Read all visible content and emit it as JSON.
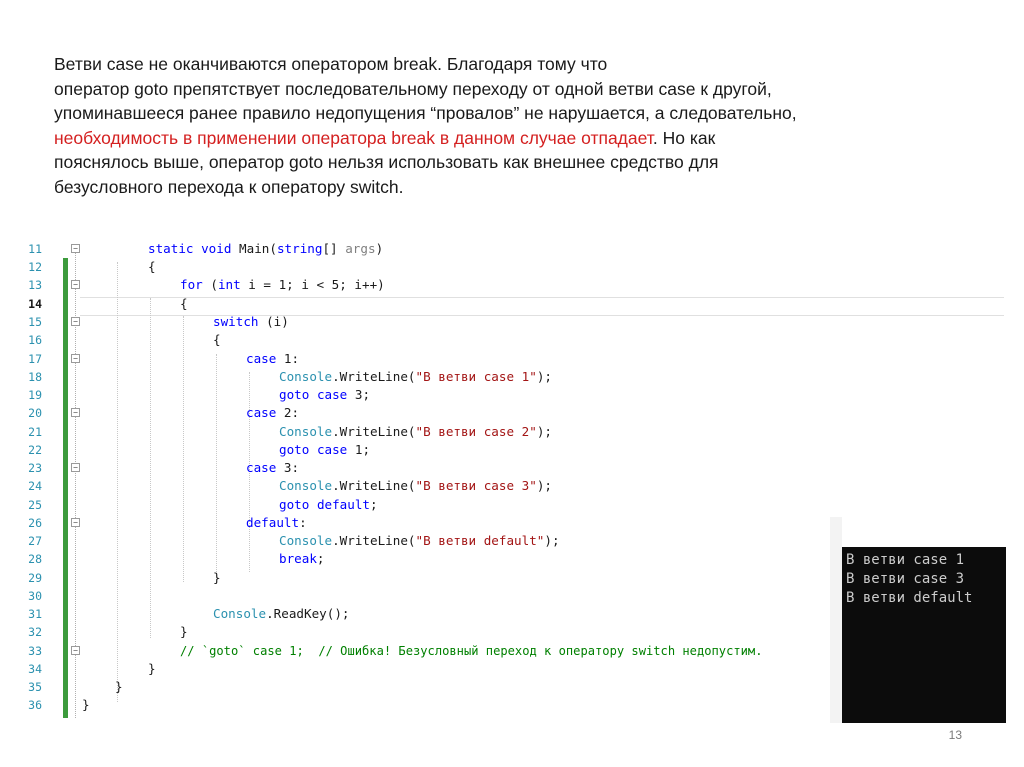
{
  "paragraph": {
    "line1": " Ветви case  не оканчиваются оператором break. Благодаря тому что",
    "line2": "оператор goto препятствует последовательному переходу от одной ветви case к другой,",
    "line3": "упоминавшееся ранее правило недопущения “провалов” не нарушается, а следовательно,",
    "line4_red": "необходимость в применении оператора break в данном случае отпадает",
    "line4_rest": ". Но как",
    "line5": "пояснялось выше, оператор goto нельзя использовать как внешнее средство для",
    "line6": "безусловного перехода к оператору switch."
  },
  "code": {
    "line_numbers": [
      "11",
      "12",
      "13",
      "14",
      "15",
      "16",
      "17",
      "18",
      "19",
      "20",
      "21",
      "22",
      "23",
      "24",
      "25",
      "26",
      "27",
      "28",
      "29",
      "30",
      "31",
      "32",
      "33",
      "34",
      "35",
      "36"
    ],
    "current_line": "14",
    "tokens": {
      "static": "static",
      "void": "void",
      "main": "Main",
      "string": "string",
      "args_sig_rest": "[] ",
      "args": "args",
      "paren_close": ")",
      "paren_open": "(",
      "brace_open": "{",
      "brace_close": "}",
      "for": "for",
      "int": "int",
      "for_rest": " i = 1; i < 5; i++)",
      "switch": "switch",
      "switch_rest": " (i)",
      "case": "case",
      "case1_rest": " 1:",
      "case2_rest": " 2:",
      "case3_rest": " 3:",
      "default": "default",
      "colon": ":",
      "console": "Console",
      "writeline": ".WriteLine(",
      "str1": "\"В ветви case 1\"",
      "str2": "\"В ветви case 2\"",
      "str3": "\"В ветви case 3\"",
      "str_default": "\"В ветви default\"",
      "close_semi": ");",
      "goto": "goto",
      "goto_case3_rest": " 3;",
      "goto_case1_rest": " 1;",
      "semi": ";",
      "break": "break",
      "readkey": ".ReadKey();",
      "comment": "// `goto` case 1;  // Ошибка! Безусловный переход к оператору switch недопустим."
    }
  },
  "console_output": [
    "В ветви case 1",
    "В ветви case 3",
    "В ветви default"
  ],
  "slide_number": "13",
  "colors": {
    "keyword": "#0000ff",
    "class": "#2b91af",
    "string": "#a31515",
    "comment": "#008000",
    "emphasis_red": "#d42020"
  }
}
